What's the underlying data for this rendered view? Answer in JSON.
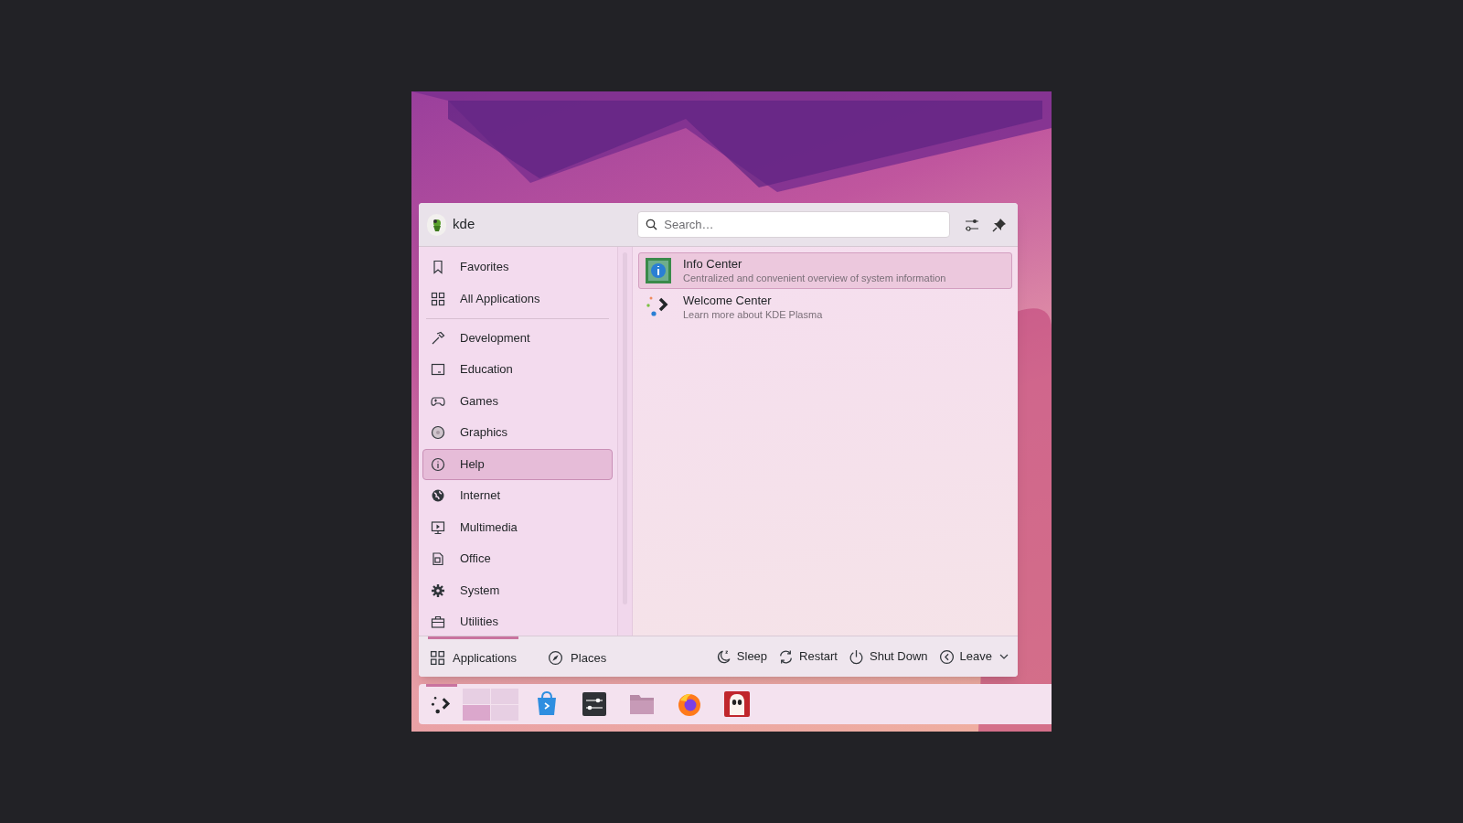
{
  "header": {
    "user": "kde"
  },
  "search": {
    "placeholder": "Search…"
  },
  "sidebar": {
    "items": [
      {
        "label": "Favorites",
        "selected": false
      },
      {
        "label": "All Applications",
        "selected": false
      }
    ],
    "categories": [
      {
        "label": "Development",
        "selected": false
      },
      {
        "label": "Education",
        "selected": false
      },
      {
        "label": "Games",
        "selected": false
      },
      {
        "label": "Graphics",
        "selected": false
      },
      {
        "label": "Help",
        "selected": true
      },
      {
        "label": "Internet",
        "selected": false
      },
      {
        "label": "Multimedia",
        "selected": false
      },
      {
        "label": "Office",
        "selected": false
      },
      {
        "label": "System",
        "selected": false
      },
      {
        "label": "Utilities",
        "selected": false
      }
    ]
  },
  "apps": [
    {
      "name": "Info Center",
      "description": "Centralized and convenient overview of system information",
      "selected": true
    },
    {
      "name": "Welcome Center",
      "description": "Learn more about KDE Plasma",
      "selected": false
    }
  ],
  "footer": {
    "tabs": [
      {
        "label": "Applications",
        "selected": true
      },
      {
        "label": "Places",
        "selected": false
      }
    ],
    "actions": [
      {
        "label": "Sleep"
      },
      {
        "label": "Restart"
      },
      {
        "label": "Shut Down"
      },
      {
        "label": "Leave"
      }
    ]
  },
  "taskbar": {
    "pager": [
      {
        "selected": false
      },
      {
        "selected": false
      },
      {
        "selected": true
      },
      {
        "selected": false
      }
    ]
  }
}
